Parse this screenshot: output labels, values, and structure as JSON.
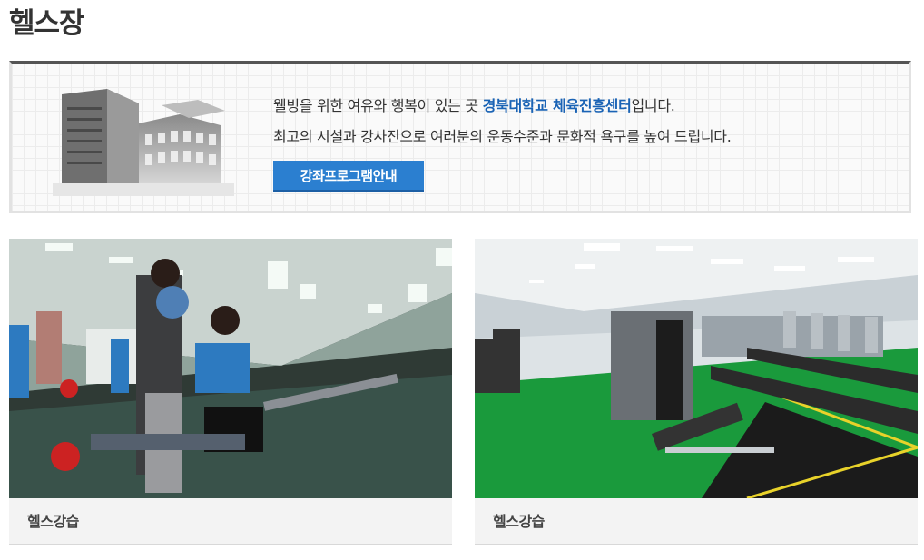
{
  "page": {
    "title": "헬스장"
  },
  "intro": {
    "line1_prefix": "웰빙을 위한 여유와 행복이 있는 곳 ",
    "line1_highlight": "경북대학교 체육진흥센터",
    "line1_suffix": "입니다.",
    "line2": "최고의 시설과 강사진으로 여러분의 운동수준과 문화적 욕구를 높여 드립니다.",
    "button_label": "강좌프로그램안내"
  },
  "gallery": [
    {
      "caption": "헬스강습"
    },
    {
      "caption": "헬스강습"
    }
  ],
  "colors": {
    "accent": "#2b7fd0",
    "highlight": "#1a63b5",
    "floor_green": "#1a9a3c"
  }
}
